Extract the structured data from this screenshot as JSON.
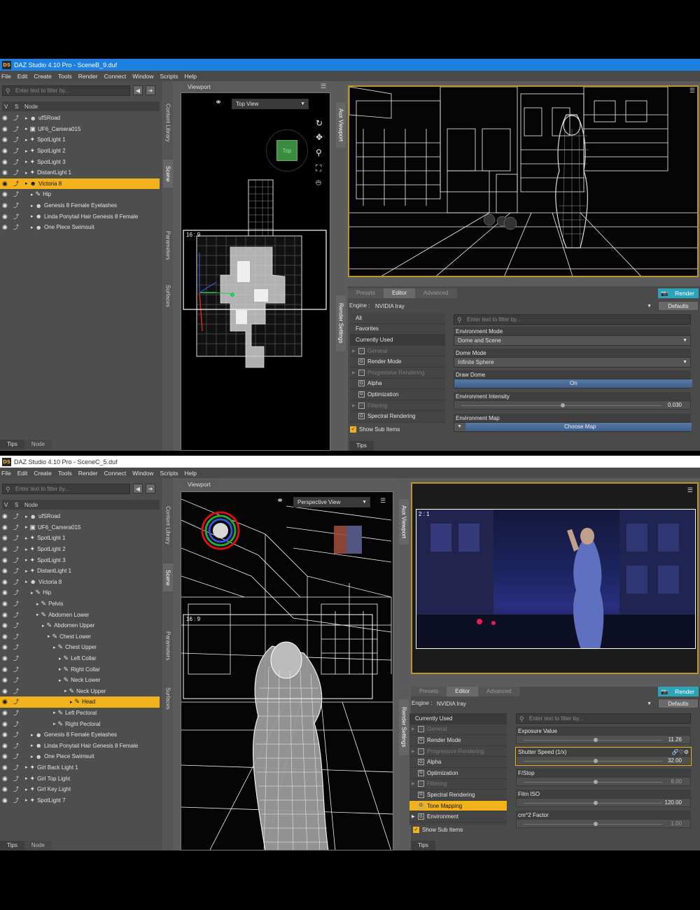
{
  "screen1": {
    "title": "DAZ Studio 4.10 Pro - SceneB_9.duf",
    "menu": [
      "File",
      "Edit",
      "Create",
      "Tools",
      "Render",
      "Connect",
      "Window",
      "Scripts",
      "Help"
    ],
    "filter_placeholder": "Enter text to filter by...",
    "cols": {
      "v": "V",
      "s": "S",
      "node": "Node"
    },
    "tree": [
      {
        "label": "ufSRoad",
        "indent": 0,
        "icon": "figure-icon",
        "selected": false
      },
      {
        "label": "UF6_Camera015",
        "indent": 0,
        "icon": "camera-icon",
        "selected": false
      },
      {
        "label": "SpotLight 1",
        "indent": 0,
        "icon": "light-icon",
        "selected": false
      },
      {
        "label": "SpotLight 2",
        "indent": 0,
        "icon": "light-icon",
        "selected": false
      },
      {
        "label": "SpotLight 3",
        "indent": 0,
        "icon": "light-icon",
        "selected": false
      },
      {
        "label": "DistantLight 1",
        "indent": 0,
        "icon": "light-icon",
        "selected": false
      },
      {
        "label": "Victoria 8",
        "indent": 0,
        "icon": "figure-icon",
        "selected": true
      },
      {
        "label": "Hip",
        "indent": 1,
        "icon": "bone-icon",
        "selected": false
      },
      {
        "label": "Genesis 8 Female Eyelashes",
        "indent": 1,
        "icon": "figure-icon",
        "selected": false
      },
      {
        "label": "Linda Ponytail Hair Genesis 8 Female",
        "indent": 1,
        "icon": "figure-icon",
        "selected": false
      },
      {
        "label": "One Piece Swimsuit",
        "indent": 1,
        "icon": "figure-icon",
        "selected": false
      }
    ],
    "vtabs": [
      "Content Library",
      "Scene",
      "Parameters",
      "Surfaces"
    ],
    "bottom_tabs": [
      "Tips",
      "Node"
    ],
    "viewport_label": "Viewport",
    "view_mode": "Top View",
    "cube_label": "Top",
    "aspect": "16 : 9",
    "aux_tab": "Aux Viewport",
    "render_tabs": [
      "Presets",
      "Editor",
      "Advanced"
    ],
    "render_button": "Render",
    "engine_label": "Engine :",
    "engine_value": "NVIDIA Iray",
    "defaults": "Defaults",
    "render_settings_tab": "Render Settings",
    "categories": [
      {
        "label": "All",
        "type": "plain"
      },
      {
        "label": "Favorites",
        "type": "plain"
      },
      {
        "label": "Currently Used",
        "type": "plain"
      },
      {
        "label": "General",
        "type": "group",
        "dim": true,
        "tri": true
      },
      {
        "label": "Render Mode",
        "type": "group",
        "dim": false,
        "tri": false
      },
      {
        "label": "Progressive Rendering",
        "type": "group",
        "dim": true,
        "tri": true
      },
      {
        "label": "Alpha",
        "type": "group",
        "dim": false,
        "tri": false
      },
      {
        "label": "Optimization",
        "type": "group",
        "dim": false,
        "tri": false
      },
      {
        "label": "Filtering",
        "type": "group",
        "dim": true,
        "tri": true
      },
      {
        "label": "Spectral Rendering",
        "type": "group",
        "dim": false,
        "tri": false
      }
    ],
    "show_sub_items": "Show Sub Items",
    "props_filter_placeholder": "Enter text to filter by...",
    "props": {
      "env_mode_label": "Environment Mode",
      "env_mode_value": "Dome and Scene",
      "dome_mode_label": "Dome Mode",
      "dome_mode_value": "Infinite Sphere",
      "draw_dome_label": "Draw Dome",
      "draw_dome_value": "On",
      "env_intensity_label": "Environment Intensity",
      "env_intensity_value": "0.030",
      "env_map_label": "Environment Map",
      "env_map_value": "Choose Map"
    },
    "tips": "Tips"
  },
  "screen2": {
    "title": "DAZ Studio 4.10 Pro - SceneC_5.duf",
    "menu": [
      "File",
      "Edit",
      "Create",
      "Tools",
      "Render",
      "Connect",
      "Window",
      "Scripts",
      "Help"
    ],
    "filter_placeholder": "Enter text to filter by...",
    "cols": {
      "v": "V",
      "s": "S",
      "node": "Node"
    },
    "tree": [
      {
        "label": "ufSRoad",
        "indent": 0,
        "icon": "figure-icon",
        "selected": false
      },
      {
        "label": "UF6_Camera015",
        "indent": 0,
        "icon": "camera-icon",
        "selected": false
      },
      {
        "label": "SpotLight 1",
        "indent": 0,
        "icon": "light-icon",
        "selected": false
      },
      {
        "label": "SpotLight 2",
        "indent": 0,
        "icon": "light-icon",
        "selected": false
      },
      {
        "label": "SpotLight 3",
        "indent": 0,
        "icon": "light-icon",
        "selected": false
      },
      {
        "label": "DistantLight 1",
        "indent": 0,
        "icon": "light-icon",
        "selected": false
      },
      {
        "label": "Victoria 8",
        "indent": 0,
        "icon": "figure-icon",
        "selected": false
      },
      {
        "label": "Hip",
        "indent": 1,
        "icon": "bone-icon",
        "selected": false
      },
      {
        "label": "Pelvis",
        "indent": 2,
        "icon": "bone-icon",
        "selected": false
      },
      {
        "label": "Abdomen Lower",
        "indent": 2,
        "icon": "bone-icon",
        "selected": false
      },
      {
        "label": "Abdomen Upper",
        "indent": 3,
        "icon": "bone-icon",
        "selected": false
      },
      {
        "label": "Chest Lower",
        "indent": 4,
        "icon": "bone-icon",
        "selected": false
      },
      {
        "label": "Chest Upper",
        "indent": 5,
        "icon": "bone-icon",
        "selected": false
      },
      {
        "label": "Left Collar",
        "indent": 6,
        "icon": "bone-icon",
        "selected": false
      },
      {
        "label": "Right Collar",
        "indent": 6,
        "icon": "bone-icon",
        "selected": false
      },
      {
        "label": "Neck Lower",
        "indent": 6,
        "icon": "bone-icon",
        "selected": false
      },
      {
        "label": "Neck Upper",
        "indent": 7,
        "icon": "bone-icon",
        "selected": false
      },
      {
        "label": "Head",
        "indent": 8,
        "icon": "bone-icon",
        "selected": true
      },
      {
        "label": "Left Pectoral",
        "indent": 5,
        "icon": "bone-icon",
        "selected": false
      },
      {
        "label": "Right Pectoral",
        "indent": 5,
        "icon": "bone-icon",
        "selected": false
      },
      {
        "label": "Genesis 8 Female Eyelashes",
        "indent": 1,
        "icon": "figure-icon",
        "selected": false
      },
      {
        "label": "Linda Ponytail Hair Genesis 8 Female",
        "indent": 1,
        "icon": "figure-icon",
        "selected": false
      },
      {
        "label": "One Piece Swimsuit",
        "indent": 1,
        "icon": "figure-icon",
        "selected": false
      },
      {
        "label": "Girl Back Light 1",
        "indent": 0,
        "icon": "light-icon",
        "selected": false
      },
      {
        "label": "Girl Top Light",
        "indent": 0,
        "icon": "light-icon",
        "selected": false
      },
      {
        "label": "Girl Key Light",
        "indent": 0,
        "icon": "light-icon",
        "selected": false
      },
      {
        "label": "SpotLight 7",
        "indent": 0,
        "icon": "light-icon",
        "selected": false
      }
    ],
    "vtabs": [
      "Content Library",
      "Scene",
      "Parameters",
      "Surfaces"
    ],
    "bottom_tabs": [
      "Tips",
      "Node"
    ],
    "viewport_label": "Viewport",
    "view_mode": "Perspective View",
    "aspect": "16 : 9",
    "aux_aspect": "2 : 1",
    "aux_tab": "Aux Viewport",
    "render_tabs": [
      "Presets",
      "Editor",
      "Advanced"
    ],
    "render_button": "Render",
    "engine_label": "Engine :",
    "engine_value": "NVIDIA Iray",
    "defaults": "Defaults",
    "render_settings_tab": "Render Settings",
    "categories": [
      {
        "label": "Currently Used",
        "type": "plain"
      },
      {
        "label": "General",
        "type": "group",
        "dim": true,
        "tri": true
      },
      {
        "label": "Render Mode",
        "type": "group",
        "dim": false,
        "tri": false
      },
      {
        "label": "Progressive Rendering",
        "type": "group",
        "dim": true,
        "tri": true
      },
      {
        "label": "Alpha",
        "type": "group",
        "dim": false,
        "tri": false
      },
      {
        "label": "Optimization",
        "type": "group",
        "dim": false,
        "tri": false
      },
      {
        "label": "Filtering",
        "type": "group",
        "dim": true,
        "tri": true
      },
      {
        "label": "Spectral Rendering",
        "type": "group",
        "dim": false,
        "tri": false
      },
      {
        "label": "Tone Mapping",
        "type": "group",
        "dim": false,
        "tri": false,
        "selected": true
      },
      {
        "label": "Environment",
        "type": "group",
        "dim": false,
        "tri": true
      }
    ],
    "show_sub_items": "Show Sub Items",
    "props_filter_placeholder": "Enter text to filter by...",
    "props": [
      {
        "label": "Exposure Value",
        "value": "11.26",
        "knob": 0.5,
        "dim": false
      },
      {
        "label": "Shutter Speed (1/x)",
        "value": "32.00",
        "knob": 0.5,
        "dim": false,
        "highlight": true
      },
      {
        "label": "F/Stop",
        "value": "8.00",
        "knob": 0.5,
        "dim": true
      },
      {
        "label": "Film ISO",
        "value": "120.00",
        "knob": 0.5,
        "dim": false
      },
      {
        "label": "cm^2 Factor",
        "value": "1.00",
        "knob": 0.5,
        "dim": true
      }
    ],
    "tips": "Tips"
  },
  "colors": {
    "accent": "#f2b21c",
    "render": "#2ba3b8",
    "titlebar1": "#1d7fe0",
    "titlebar2": "#ffffff"
  }
}
